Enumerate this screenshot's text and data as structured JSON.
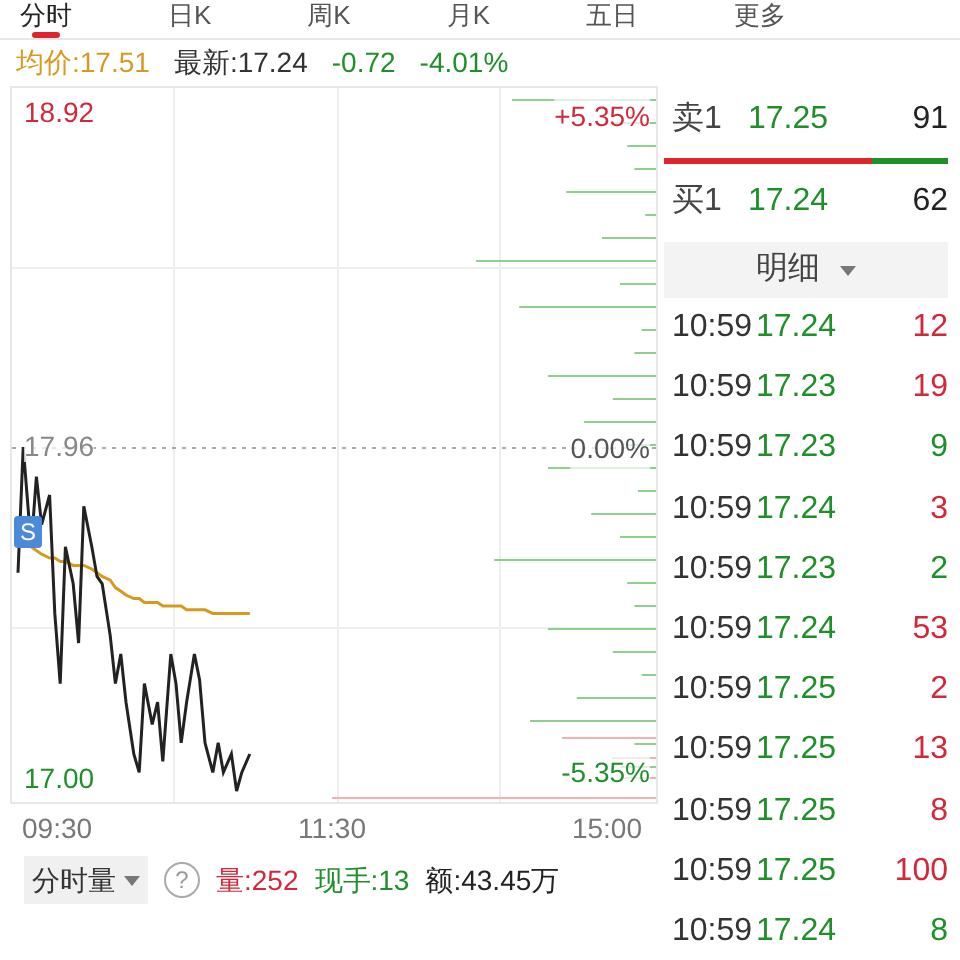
{
  "tabs": [
    {
      "label": "分时",
      "selected": true
    },
    {
      "label": "日K",
      "selected": false
    },
    {
      "label": "周K",
      "selected": false
    },
    {
      "label": "月K",
      "selected": false
    },
    {
      "label": "五日",
      "selected": false
    },
    {
      "label": "更多",
      "selected": false
    }
  ],
  "info": {
    "avg": "均价:17.51",
    "latest": "最新:17.24",
    "change": "-0.72",
    "change_pct": "-4.01%"
  },
  "chart": {
    "high_pct": "+5.35%",
    "base_pct": "0.00%",
    "low_pct": "-5.35%",
    "marker": "S",
    "times": [
      "09:30",
      "11:30",
      "15:00"
    ],
    "prices": [
      "18.92",
      "17.96",
      "17.00"
    ]
  },
  "volume_bar": {
    "selector": "分时量",
    "help": "?",
    "volume": "量:252",
    "current": "现手:13",
    "amount": "额:43.45万"
  },
  "quotes": [
    {
      "label": "卖1",
      "price": "17.25",
      "qty": "91"
    },
    {
      "label": "买1",
      "price": "17.24",
      "qty": "62"
    }
  ],
  "detail_header": "明细",
  "trades": [
    {
      "time": "10:59",
      "price": "17.24",
      "qty": "12",
      "color": "#d2283a"
    },
    {
      "time": "10:59",
      "price": "17.23",
      "qty": "19",
      "color": "#d2283a"
    },
    {
      "time": "10:59",
      "price": "17.23",
      "qty": "9",
      "color": "#1f8f2a"
    },
    {
      "time": "10:59",
      "price": "17.24",
      "qty": "3",
      "color": "#d2283a"
    },
    {
      "time": "10:59",
      "price": "17.23",
      "qty": "2",
      "color": "#1f8f2a"
    },
    {
      "time": "10:59",
      "price": "17.24",
      "qty": "53",
      "color": "#d2283a"
    },
    {
      "time": "10:59",
      "price": "17.25",
      "qty": "2",
      "color": "#d2283a"
    },
    {
      "time": "10:59",
      "price": "17.25",
      "qty": "13",
      "color": "#d2283a"
    },
    {
      "time": "10:59",
      "price": "17.25",
      "qty": "8",
      "color": "#d2283a"
    },
    {
      "time": "10:59",
      "price": "17.25",
      "qty": "100",
      "color": "#d2283a"
    },
    {
      "time": "10:59",
      "price": "17.24",
      "qty": "8",
      "color": "#1f8f2a"
    }
  ]
}
